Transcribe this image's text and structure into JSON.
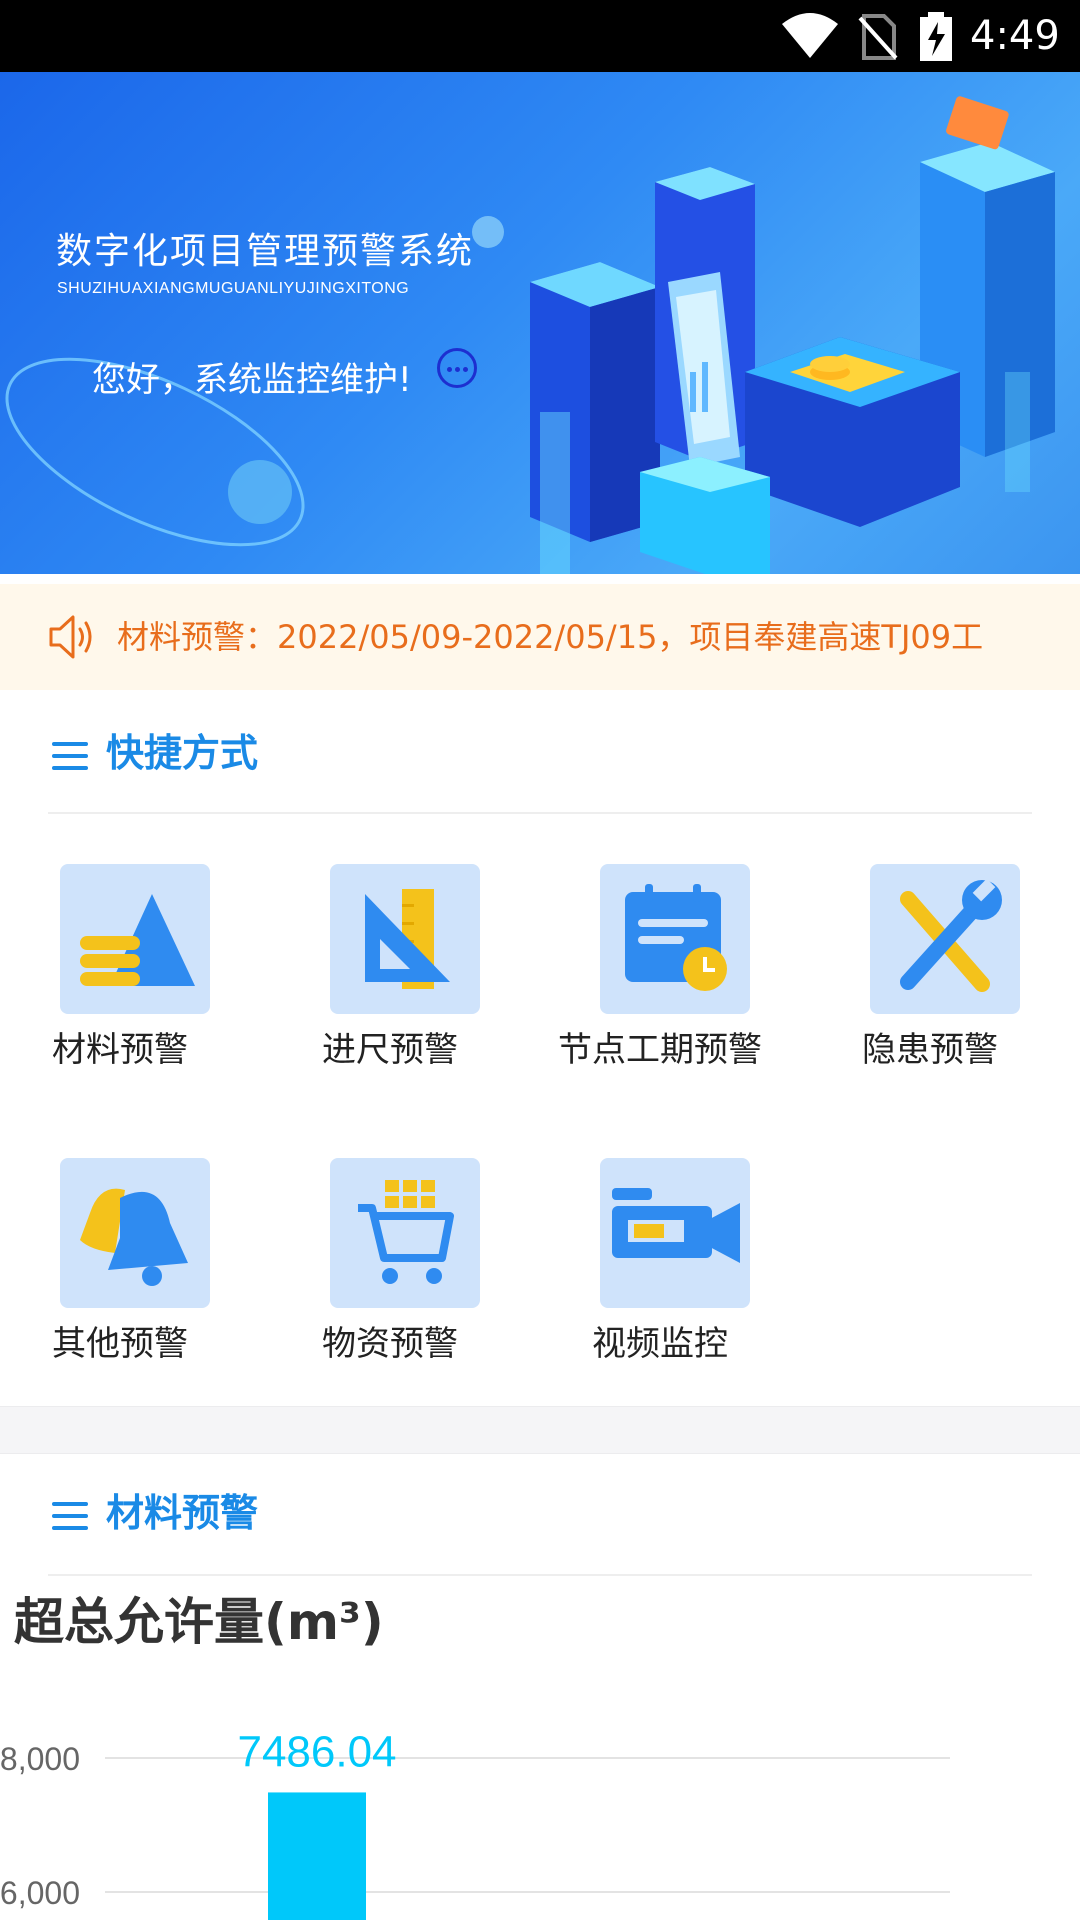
{
  "status_bar": {
    "time": "4:49"
  },
  "banner": {
    "title": "数字化项目管理预警系统",
    "subtitle": "SHUZIHUAXIANGMUGUANLIYUJINGXITONG",
    "greeting": "您好，系统监控维护!"
  },
  "notice": {
    "text": "材料预警：2022/05/09-2022/05/15，项目奉建高速TJ09工"
  },
  "shortcuts": {
    "title": "快捷方式",
    "items": [
      {
        "label": "材料预警",
        "icon": "material-warning-icon"
      },
      {
        "label": "进尺预警",
        "icon": "ruler-triangle-icon"
      },
      {
        "label": "节点工期预警",
        "icon": "calendar-clock-icon"
      },
      {
        "label": "隐患预警",
        "icon": "wrench-screwdriver-icon"
      },
      {
        "label": "其他预警",
        "icon": "bell-icon"
      },
      {
        "label": "物资预警",
        "icon": "cart-icon"
      },
      {
        "label": "视频监控",
        "icon": "video-camera-icon"
      }
    ]
  },
  "material_section": {
    "title": "材料预警",
    "chart_title": "超总允许量(m³)"
  },
  "colors": {
    "accent": "#1a8ae6",
    "notice_text": "#e86d1c",
    "bar": "#00c8fa",
    "tile": "#cfe3fb"
  },
  "chart_data": {
    "type": "bar",
    "title": "超总允许量(m³)",
    "categories": [
      ""
    ],
    "values": [
      7486.04
    ],
    "data_labels": [
      "7486.04"
    ],
    "y_ticks": [
      6000,
      8000
    ],
    "y_tick_labels": [
      "6,000",
      "8,000"
    ],
    "ylim": [
      5000,
      8000
    ],
    "grid": true
  }
}
